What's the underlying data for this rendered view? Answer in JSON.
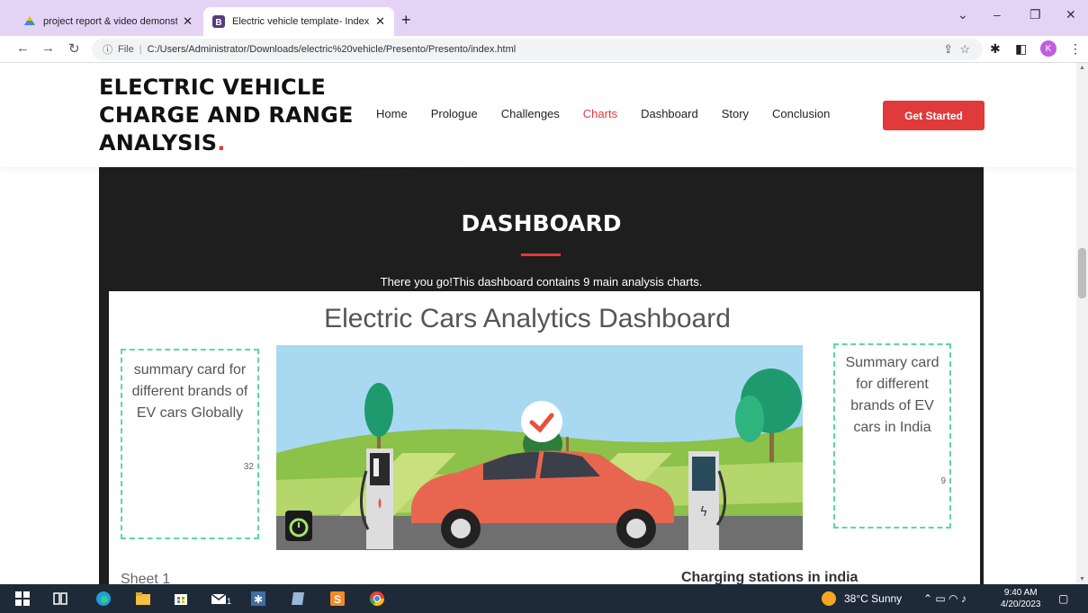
{
  "browser": {
    "tabs": [
      {
        "title": "project report & video demonstr",
        "active": false
      },
      {
        "title": "Electric vehicle template- Index",
        "active": true
      }
    ],
    "new_tab": "+",
    "url_prefix": "File",
    "url": "C:/Users/Administrator/Downloads/electric%20vehicle/Presento/Presento/index.html",
    "profile_initial": "K"
  },
  "site": {
    "logo_text": "ELECTRIC VEHICLE CHARGE AND RANGE ANALYSIS",
    "logo_dot": ".",
    "nav": [
      "Home",
      "Prologue",
      "Challenges",
      "Charts",
      "Dashboard",
      "Story",
      "Conclusion"
    ],
    "active_nav": "Charts",
    "cta_label": "Get Started"
  },
  "dashboard": {
    "section_title": "DASHBOARD",
    "subtitle": "There you go!This dashboard contains 9 main analysis charts.",
    "panel_title": "Electric Cars Analytics Dashboard",
    "left_card_text": "summary card for different brands of EV cars Globally",
    "left_card_value": "32",
    "right_card_text": "Summary card for different brands of EV cars in India",
    "right_card_value": "9",
    "sheet_label": "Sheet 1",
    "stations_label": "Charging stations in india"
  },
  "taskbar": {
    "weather": "38°C  Sunny",
    "time": "9:40 AM",
    "date": "4/20/2023",
    "mail_badge": "1"
  },
  "colors": {
    "accent": "#e03a3a",
    "card_border": "#5fd6a6",
    "dark_section": "#1e1e1e",
    "tabbar": "#e5d3f5"
  }
}
